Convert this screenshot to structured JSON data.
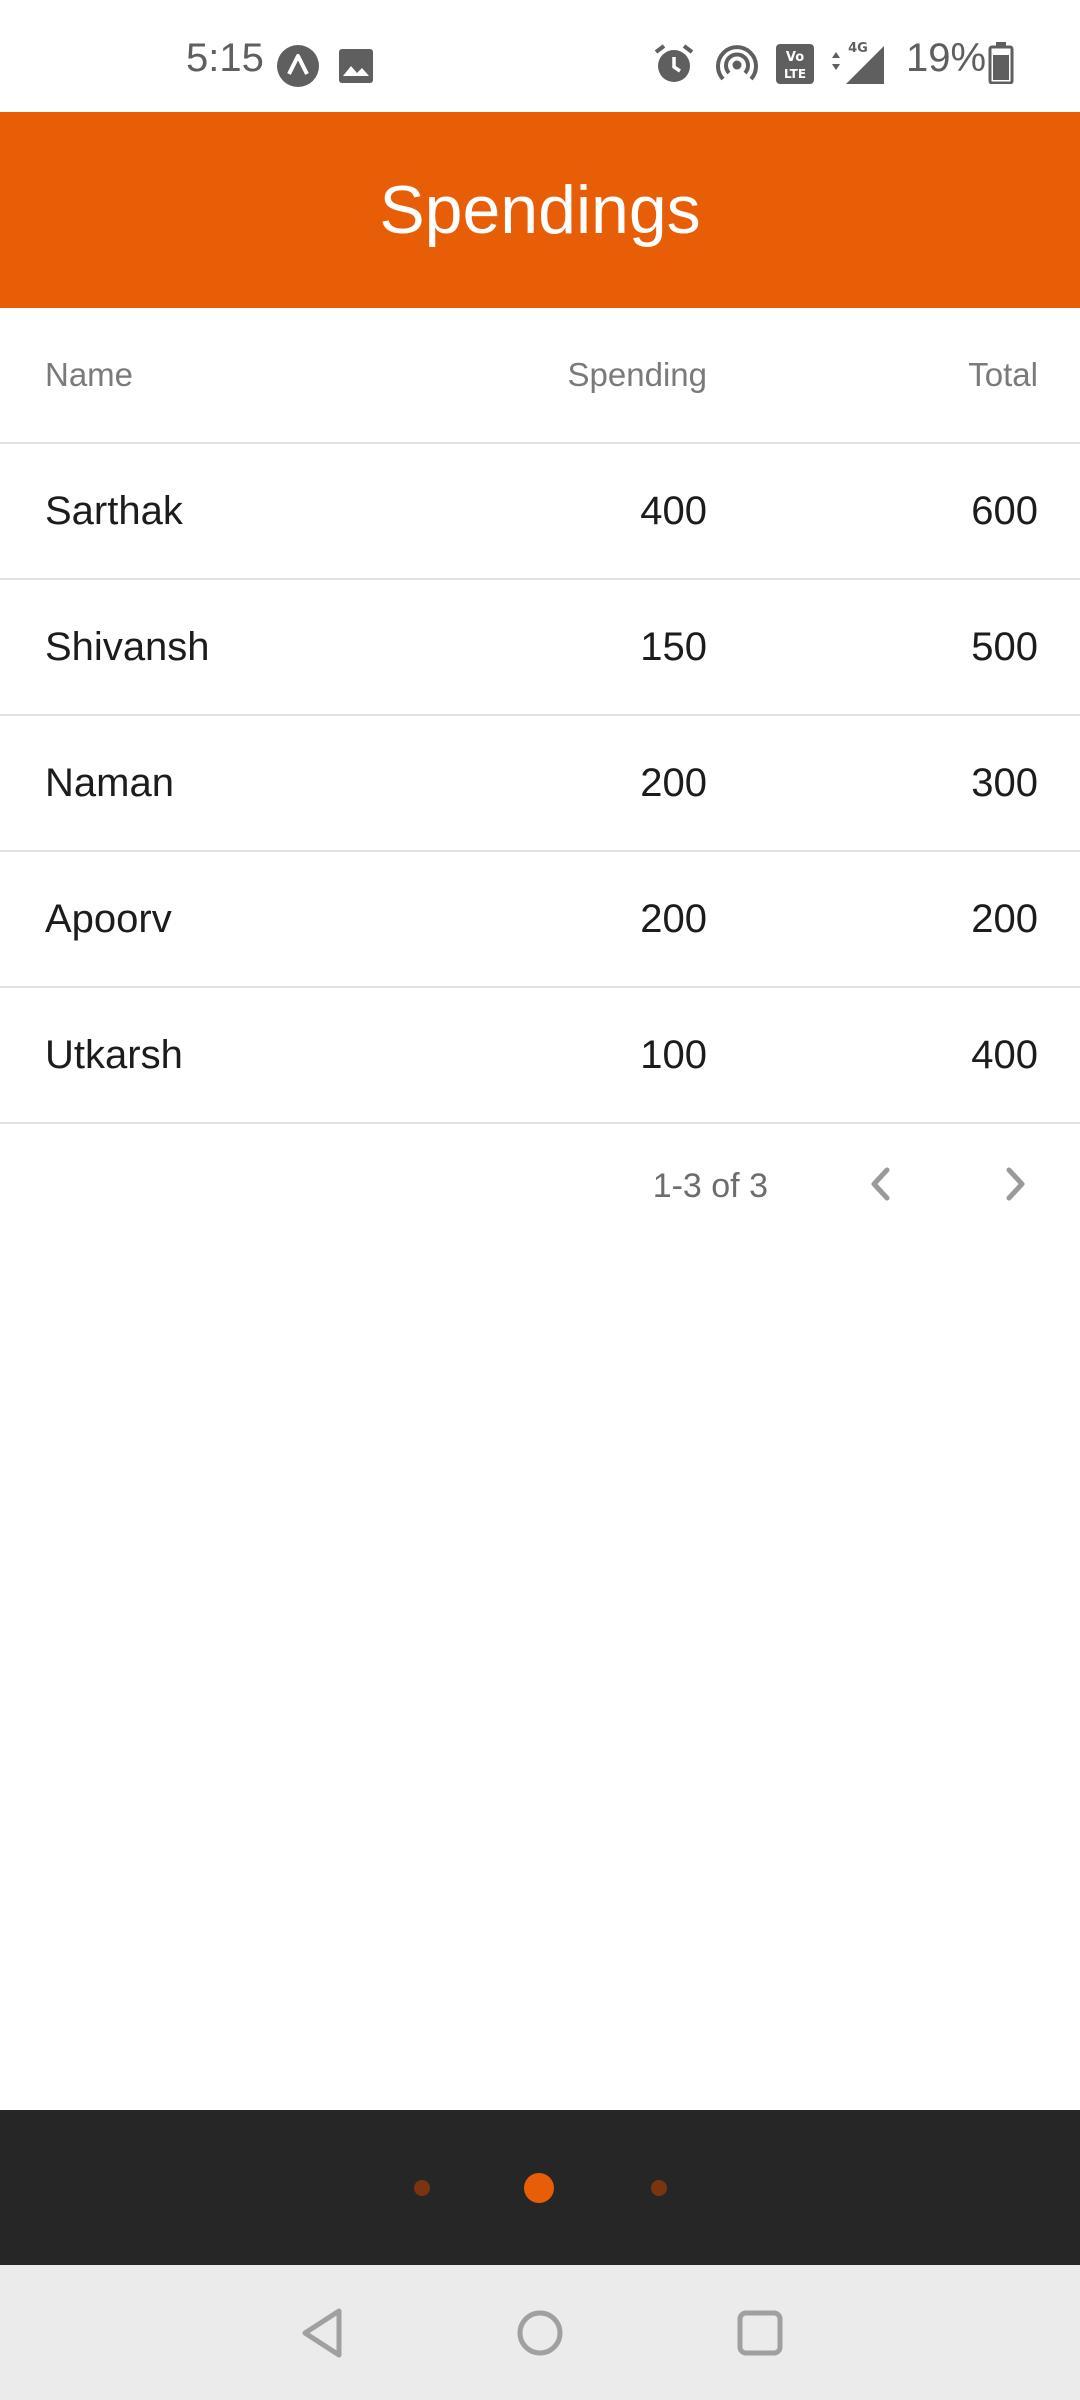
{
  "status_bar": {
    "time": "5:15",
    "battery_percent": "19%",
    "icons": [
      "app-notification-icon",
      "image-icon",
      "alarm-icon",
      "hotspot-icon",
      "volte-icon",
      "signal-4g-icon",
      "battery-icon"
    ]
  },
  "header": {
    "title": "Spendings",
    "color": "#e85e07"
  },
  "table": {
    "columns": [
      "Name",
      "Spending",
      "Total"
    ],
    "rows": [
      {
        "name": "Sarthak",
        "spending": "400",
        "total": "600"
      },
      {
        "name": "Shivansh",
        "spending": "150",
        "total": "500"
      },
      {
        "name": "Naman",
        "spending": "200",
        "total": "300"
      },
      {
        "name": "Apoorv",
        "spending": "200",
        "total": "200"
      },
      {
        "name": "Utkarsh",
        "spending": "100",
        "total": "400"
      }
    ]
  },
  "pagination": {
    "range_label": "1-3 of 3",
    "prev_icon": "chevron-left-icon",
    "next_icon": "chevron-right-icon"
  },
  "page_indicator": {
    "pages": 3,
    "active_page": 2,
    "active_color": "#e85e07"
  },
  "nav_bar": {
    "icons": [
      "back-icon",
      "home-icon",
      "recents-icon"
    ]
  }
}
